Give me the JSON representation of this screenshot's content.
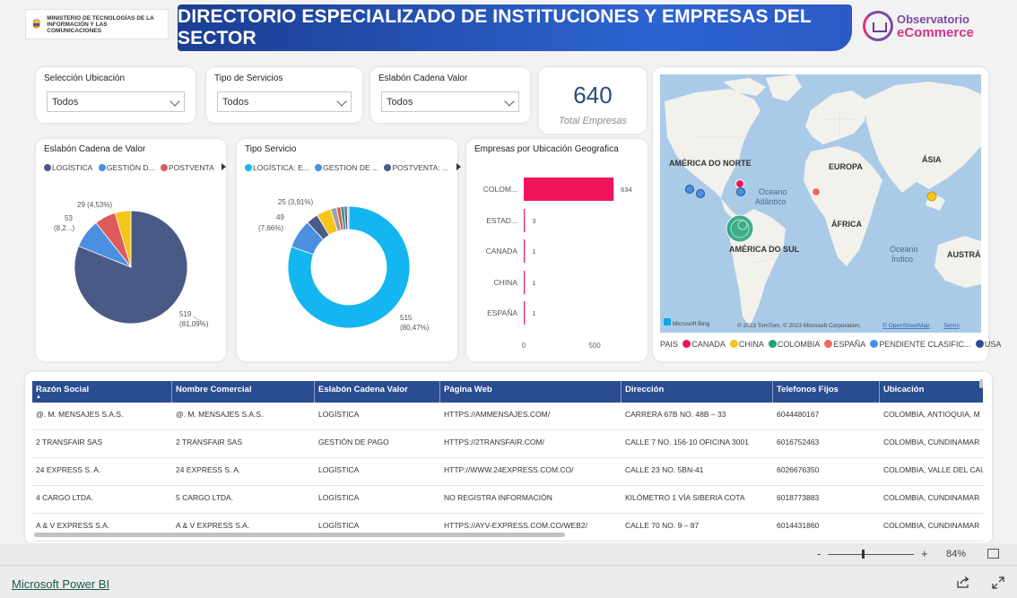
{
  "header": {
    "ministry": "MINISTERIO DE TECNOLOGÍAS DE LA INFORMACIÓN Y LAS COMUNICACIONES",
    "title": "DIRECTORIO ESPECIALIZADO DE INSTITUCIONES Y EMPRESAS DEL SECTOR",
    "logo_line1": "Observatorio",
    "logo_line2": "eCommerce"
  },
  "slicers": [
    {
      "label": "Selección Ubicación",
      "value": "Todos"
    },
    {
      "label": "Tipo de Servicios",
      "value": "Todos"
    },
    {
      "label": "Eslabón Cadena Valor",
      "value": "Todos"
    }
  ],
  "kpi": {
    "value": "640",
    "caption": "Total Empresas"
  },
  "pie1": {
    "title": "Eslabón Cadena de Valor",
    "legend": [
      {
        "label": "LOGÍSTICA",
        "color": "#4a5a87"
      },
      {
        "label": "GESTIÓN D...",
        "color": "#4a8fe0"
      },
      {
        "label": "POSTVENTA",
        "color": "#e05a5a"
      }
    ],
    "labels": {
      "main_v": "519",
      "main_p": "(81,09%)",
      "b_v": "53",
      "b_p": "(8,2...)",
      "c": "29 (4,53%)"
    }
  },
  "donut": {
    "title": "Tipo Servicio",
    "legend": [
      {
        "label": "LOGÍSTICA: E...",
        "color": "#13b6f0"
      },
      {
        "label": "GESTION DE ...",
        "color": "#4a8fe0"
      },
      {
        "label": "POSTVENTA: ...",
        "color": "#4a5a87"
      }
    ],
    "labels": {
      "main_v": "515",
      "main_p": "(80,47%)",
      "b_v": "49",
      "b_p": "(7,66%)",
      "c": "25 (3,91%)"
    }
  },
  "chart_data": [
    {
      "type": "pie",
      "title": "Eslabón Cadena de Valor",
      "slices": [
        {
          "name": "LOGÍSTICA",
          "value": 519,
          "color": "#4a5a87"
        },
        {
          "name": "GESTIÓN D...",
          "value": 53,
          "color": "#4a8fe0"
        },
        {
          "name": "POSTVENTA",
          "value": 39,
          "color": "#e05a5a"
        },
        {
          "name": "",
          "value": 29,
          "color": "#f5c518"
        }
      ]
    },
    {
      "type": "pie",
      "title": "Tipo Servicio",
      "donut": true,
      "slices": [
        {
          "name": "LOGÍSTICA: E...",
          "value": 515,
          "color": "#13b6f0"
        },
        {
          "name": "GESTION DE ...",
          "value": 49,
          "color": "#4a8fe0"
        },
        {
          "name": "POSTVENTA: ...",
          "value": 20,
          "color": "#4a5a87"
        },
        {
          "name": "",
          "value": 25,
          "color": "#f5c518"
        },
        {
          "name": "",
          "value": 10,
          "color": "#9aa3ad"
        },
        {
          "name": "",
          "value": 7,
          "color": "#e05a5a"
        },
        {
          "name": "",
          "value": 6,
          "color": "#1fa37a"
        },
        {
          "name": "",
          "value": 5,
          "color": "#6b4ea0"
        },
        {
          "name": "",
          "value": 3,
          "color": "#c8c8c8"
        }
      ]
    },
    {
      "type": "bar",
      "orientation": "horizontal",
      "title": "Empresas por Ubicación Geografica",
      "categories": [
        "COLOM...",
        "ESTAD...",
        "CANADA",
        "CHINA",
        "ESPAÑA"
      ],
      "values": [
        634,
        3,
        1,
        1,
        1
      ],
      "xlim": [
        0,
        650
      ],
      "xticks": [
        "0",
        "500"
      ],
      "color": "#f0145a"
    }
  ],
  "map": {
    "labels": [
      "AMÉRICA DO NORTE",
      "EUROPA",
      "ÁSIA",
      "ÁFRICA",
      "AMÉRICA DO SUL",
      "AUSTRÁ"
    ],
    "ocean_atl_1": "Oceano",
    "ocean_atl_2": "Atlântico",
    "ocean_ind_1": "Oceano",
    "ocean_ind_2": "Índico",
    "bing": "Microsoft Bing",
    "copyright": "© 2023 TomTom, © 2023 Microsoft Corporation,",
    "osm": "© OpenStreetMap",
    "terms": "Terms",
    "legend_title": "PAIS",
    "legend": [
      {
        "label": "CANADA",
        "color": "#f0145a"
      },
      {
        "label": "CHINA",
        "color": "#f5c518"
      },
      {
        "label": "COLOMBIA",
        "color": "#1fa37a"
      },
      {
        "label": "ESPAÑA",
        "color": "#ee6b5a"
      },
      {
        "label": "PENDIENTE CLASIFIC...",
        "color": "#4a8fe0"
      },
      {
        "label": "USA",
        "color": "#2a4c91"
      }
    ]
  },
  "table": {
    "columns": [
      "Razón Social",
      "Nombre Comercial",
      "Eslabón Cadena Valor",
      "Página Web",
      "Dirección",
      "Telefonos Fijos",
      "Ubicación"
    ],
    "rows": [
      [
        "@. M. MENSAJES S.A.S.",
        "@. M. MENSAJES S.A.S.",
        "LOGÍSTICA",
        "HTTPS://AMMENSAJES.COM/",
        "CARRERA 67B NO. 48B – 33",
        "6044480167",
        "COLOMBIA, ANTIOQUIA, M"
      ],
      [
        "2 TRANSFAIR SAS",
        "2 TRANSFAIR SAS",
        "GESTIÓN DE PAGO",
        "HTTPS://2TRANSFAIR.COM/",
        "CALLE 7 NO. 156-10 OFICINA 3001",
        "6016752463",
        "COLOMBIA, CUNDINAMAR"
      ],
      [
        "24 EXPRESS S. A.",
        "24 EXPRESS S. A.",
        "LOGÍSTICA",
        "HTTP://WWW.24EXPRESS.COM.CO/",
        "CALLE 23 NO. 5BN-41",
        "6026676350",
        "COLOMBIA, VALLE DEL CAU"
      ],
      [
        "4 CARGO LTDA.",
        "5 CARGO LTDA.",
        "LOGÍSTICA",
        "NO REGISTRA INFORMACIÓN",
        "KILÓMETRO 1 VÍA SIBERIA COTA",
        "6018773883",
        "COLOMBIA, CUNDINAMAR"
      ],
      [
        "A & V EXPRESS S.A.",
        "A & V EXPRESS S.A.",
        "LOGÍSTICA",
        "HTTPS://AYV-EXPRESS.COM.CO/WEB2/",
        "CALLE 70 NO. 9 – 87",
        "6014431860",
        "COLOMBIA, CUNDINAMAR"
      ]
    ]
  },
  "zoom": {
    "minus": "-",
    "plus": "+",
    "value": "84%"
  },
  "footer": {
    "brand": "Microsoft Power BI"
  }
}
